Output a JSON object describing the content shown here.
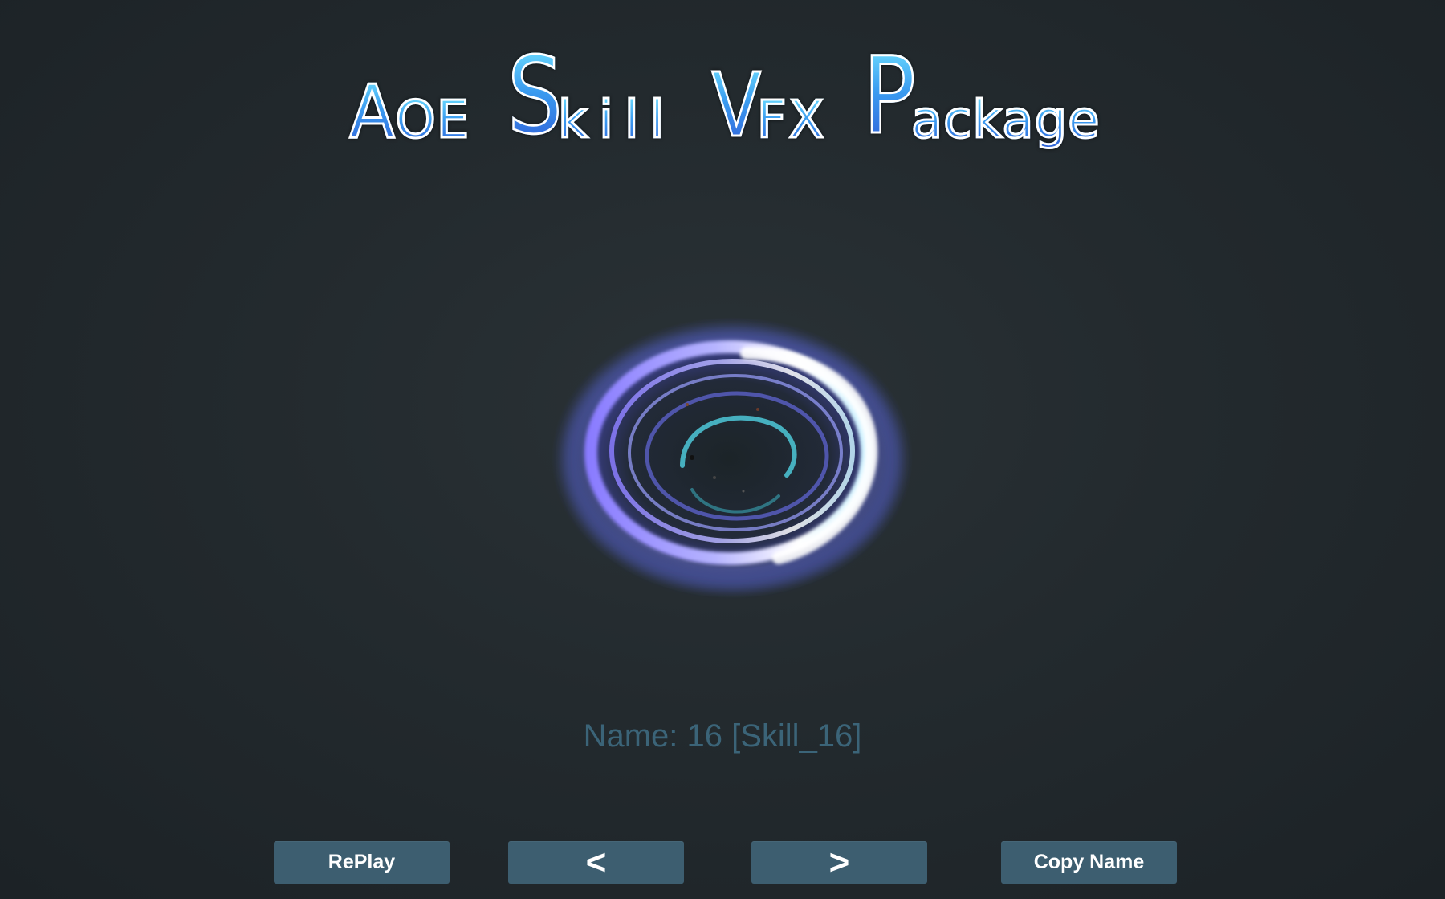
{
  "title": {
    "words": [
      {
        "cap": "A",
        "rest": "OE"
      },
      {
        "cap": "S",
        "rest": "kill"
      },
      {
        "cap": "V",
        "rest": "FX"
      },
      {
        "cap": "P",
        "rest": "ackage"
      }
    ]
  },
  "effect": {
    "name_label": "Name: 16 [Skill_16]"
  },
  "buttons": {
    "replay": "RePlay",
    "prev": "<",
    "next": ">",
    "copy": "Copy Name"
  },
  "colors": {
    "background": "#232a2e",
    "button": "#3d5e70",
    "name_text": "#3b6478",
    "title_gradient_top": "#6fe0ff",
    "title_gradient_bottom": "#2f5fd8"
  }
}
